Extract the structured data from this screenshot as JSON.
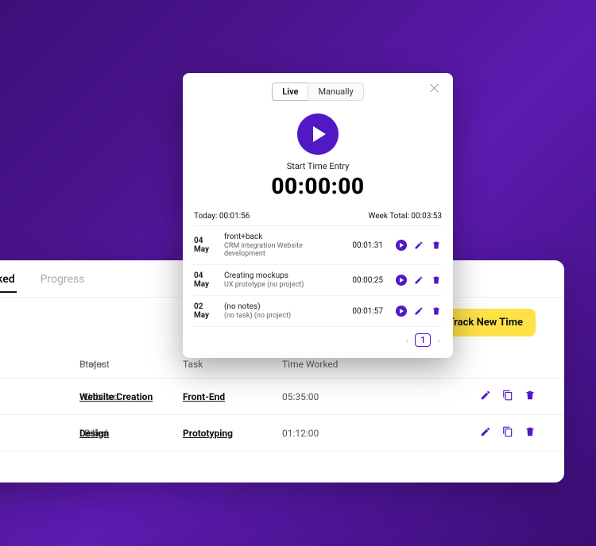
{
  "colors": {
    "accent": "#5119c6",
    "cta": "#ffe148"
  },
  "bg": {
    "tabs": {
      "active": "ked",
      "other": "Progress"
    },
    "track_btn": "Track New Time",
    "headers": {
      "status": "Status",
      "project": "Project",
      "task": "Task",
      "time": "Time Worked"
    },
    "rows": [
      {
        "status": "Unbilled",
        "project": "Website Creation",
        "task": "Front-End",
        "time": "05:35:00"
      },
      {
        "status": "Billed",
        "project": "Design",
        "task": "Prototyping",
        "time": "01:12:00"
      }
    ]
  },
  "pop": {
    "tabs": {
      "live": "Live",
      "manually": "Manually"
    },
    "start_label": "Start Time Entry",
    "big_time": "00:00:00",
    "today_label": "Today:",
    "today_val": "00:01:56",
    "week_label": "Week Total:",
    "week_val": "00:03:53",
    "entries": [
      {
        "d": "04",
        "m": "May",
        "l1": "front+back",
        "l2": "CRM integration Website development",
        "dur": "00:01:31"
      },
      {
        "d": "04",
        "m": "May",
        "l1": "Creating mockups",
        "l2": "UX prototype (no project)",
        "dur": "00:00:25"
      },
      {
        "d": "02",
        "m": "May",
        "l1": "(no notes)",
        "l2": "(no task) (no project)",
        "dur": "00:01:57"
      }
    ],
    "page": "1"
  }
}
